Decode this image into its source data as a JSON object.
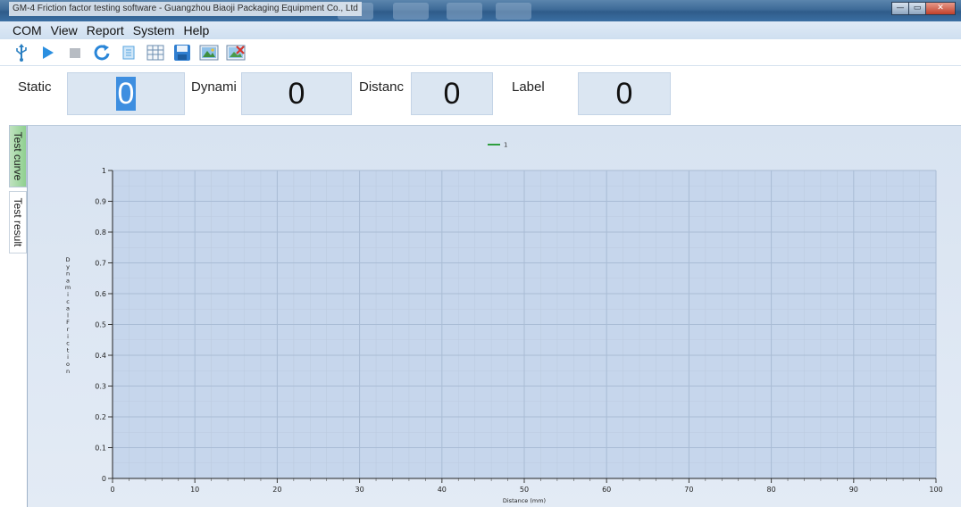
{
  "window": {
    "title": "GM-4  Friction factor testing software - Guangzhou Biaoji Packaging Equipment Co., Ltd",
    "controls": {
      "minimize": "—",
      "maximize": "▭",
      "close": "✕"
    }
  },
  "menu": [
    {
      "label": "COM"
    },
    {
      "label": "View"
    },
    {
      "label": "Report"
    },
    {
      "label": "System"
    },
    {
      "label": "Help"
    }
  ],
  "toolbar": [
    {
      "name": "usb-icon"
    },
    {
      "name": "play-icon"
    },
    {
      "name": "stop-icon"
    },
    {
      "name": "refresh-icon"
    },
    {
      "name": "document-icon"
    },
    {
      "name": "table-icon"
    },
    {
      "name": "save-icon"
    },
    {
      "name": "image-export-icon"
    },
    {
      "name": "image-delete-icon"
    }
  ],
  "values": {
    "static": {
      "label": "Static",
      "value": "0"
    },
    "dynamic": {
      "label": "Dynami",
      "value": "0"
    },
    "distance": {
      "label": "Distanc",
      "value": "0"
    },
    "label": {
      "label": "Label",
      "value": "0"
    }
  },
  "tabs": [
    {
      "label": "Test curve",
      "active": true
    },
    {
      "label": "Test result",
      "active": false
    }
  ],
  "chart_data": {
    "type": "line",
    "title": "",
    "xlabel": "Distance (mm)",
    "ylabel": "DynamicalFriction",
    "xlim": [
      0,
      100
    ],
    "ylim": [
      0,
      1
    ],
    "x_ticks": [
      "0",
      "10",
      "20",
      "30",
      "40",
      "50",
      "60",
      "70",
      "80",
      "90",
      "100"
    ],
    "y_ticks": [
      "0",
      "0.1",
      "0.2",
      "0.3",
      "0.4",
      "0.5",
      "0.6",
      "0.7",
      "0.8",
      "0.9",
      "1"
    ],
    "grid": true,
    "legend_position": "top-center",
    "series": [
      {
        "name": "1",
        "color": "#2e9e3e",
        "x": [],
        "y": []
      }
    ],
    "colors": {
      "plot_background": "#c6d6ec",
      "panel_background": "#dae5f2",
      "grid_major": "#a9bcd5",
      "grid_minor": "#bccbe0"
    }
  }
}
